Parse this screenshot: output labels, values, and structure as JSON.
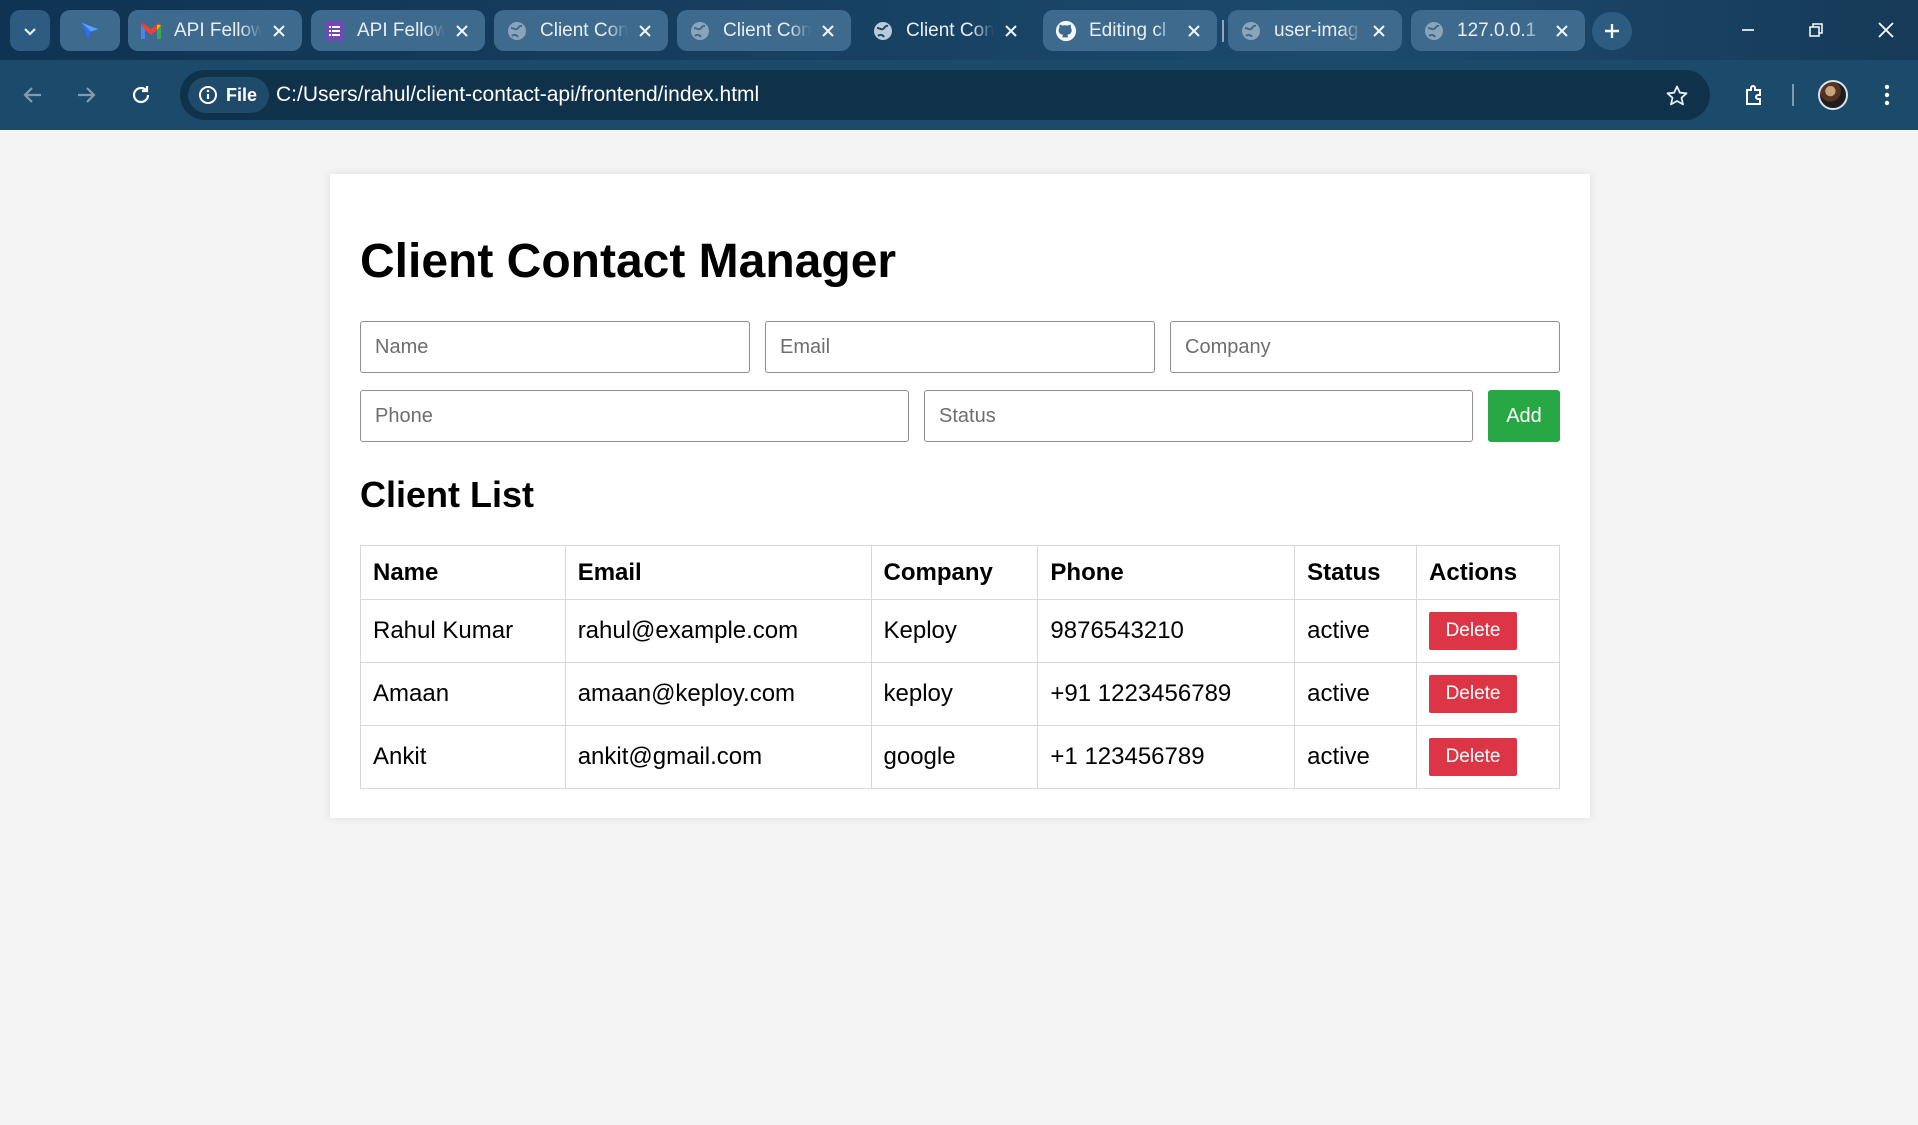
{
  "browser": {
    "tabs": [
      {
        "title": "",
        "favicon": "arrow-cursor-icon",
        "active": false
      },
      {
        "title": "API Fellow",
        "favicon": "gmail-icon",
        "active": false
      },
      {
        "title": "API Fellow",
        "favicon": "forms-icon",
        "active": false
      },
      {
        "title": "Client Cont",
        "favicon": "globe-icon",
        "active": false
      },
      {
        "title": "Client Cont",
        "favicon": "globe-icon",
        "active": false
      },
      {
        "title": "Client Cont",
        "favicon": "globe-icon",
        "active": true
      },
      {
        "title": "Editing cl",
        "favicon": "github-icon",
        "active": false
      },
      {
        "title": "user-imag",
        "favicon": "globe-icon",
        "active": false
      },
      {
        "title": "127.0.0.1",
        "favicon": "globe-icon",
        "active": false
      }
    ],
    "address": {
      "scheme_chip": "File",
      "url": "C:/Users/rahul/client-contact-api/frontend/index.html"
    },
    "colors": {
      "tabstrip": "#163f60",
      "toolbar": "#1b4a6b",
      "omnibox": "#0f3149"
    }
  },
  "app": {
    "title": "Client Contact Manager",
    "form": {
      "name_placeholder": "Name",
      "email_placeholder": "Email",
      "company_placeholder": "Company",
      "phone_placeholder": "Phone",
      "status_placeholder": "Status",
      "add_label": "Add"
    },
    "list_title": "Client List",
    "table": {
      "headers": [
        "Name",
        "Email",
        "Company",
        "Phone",
        "Status",
        "Actions"
      ],
      "rows": [
        {
          "name": "Rahul Kumar",
          "email": "rahul@example.com",
          "company": "Keploy",
          "phone": "9876543210",
          "status": "active",
          "action": "Delete"
        },
        {
          "name": "Amaan",
          "email": "amaan@keploy.com",
          "company": "keploy",
          "phone": "+91 1223456789",
          "status": "active",
          "action": "Delete"
        },
        {
          "name": "Ankit",
          "email": "ankit@gmail.com",
          "company": "google",
          "phone": "+1 123456789",
          "status": "active",
          "action": "Delete"
        }
      ]
    },
    "colors": {
      "add_button": "#28a745",
      "delete_button": "#dc3545"
    }
  }
}
